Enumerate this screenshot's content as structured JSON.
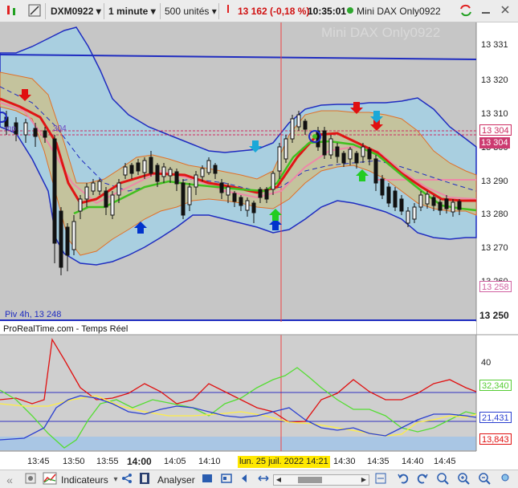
{
  "toolbar": {
    "symbol": "DXM0922",
    "interval": "1 minute",
    "units": "500 unités",
    "quote": "13 162 (-0,18 %)",
    "time": "10:35:01",
    "instrument": "Mini DAX Only0922"
  },
  "chart": {
    "watermark": "Mini DAX Only0922",
    "pivot_label": "Piv 4h, 13 248",
    "indicator_label": "mp",
    "indicator_tail": "304",
    "source_label": "ProRealTime.com - Temps Réel",
    "cursor_time": "lun. 25 juil. 2022 14:21",
    "price_ticks": [
      "13 331",
      "13 320",
      "13 310",
      "13 300",
      "13 290",
      "13 280",
      "13 270",
      "13 260",
      "13 250"
    ],
    "price_tags": [
      "13 304",
      "13 304",
      "13 258"
    ],
    "osc_ticks": [
      "40"
    ],
    "osc_tags": [
      "32,340",
      "21,431",
      "13,843"
    ],
    "time_ticks": [
      "13:45",
      "13:50",
      "13:55",
      "14:00",
      "14:05",
      "14:10",
      "14:30",
      "14:35",
      "14:40",
      "14:45"
    ]
  },
  "bottom": {
    "indicators_label": "Indicateurs",
    "analyse_label": "Analyser"
  },
  "colors": {
    "up_arrow": "#0033cc",
    "down_arrow": "#e01010",
    "green_arrow": "#22cc22",
    "cyan_arrow": "#1aa8d8"
  }
}
